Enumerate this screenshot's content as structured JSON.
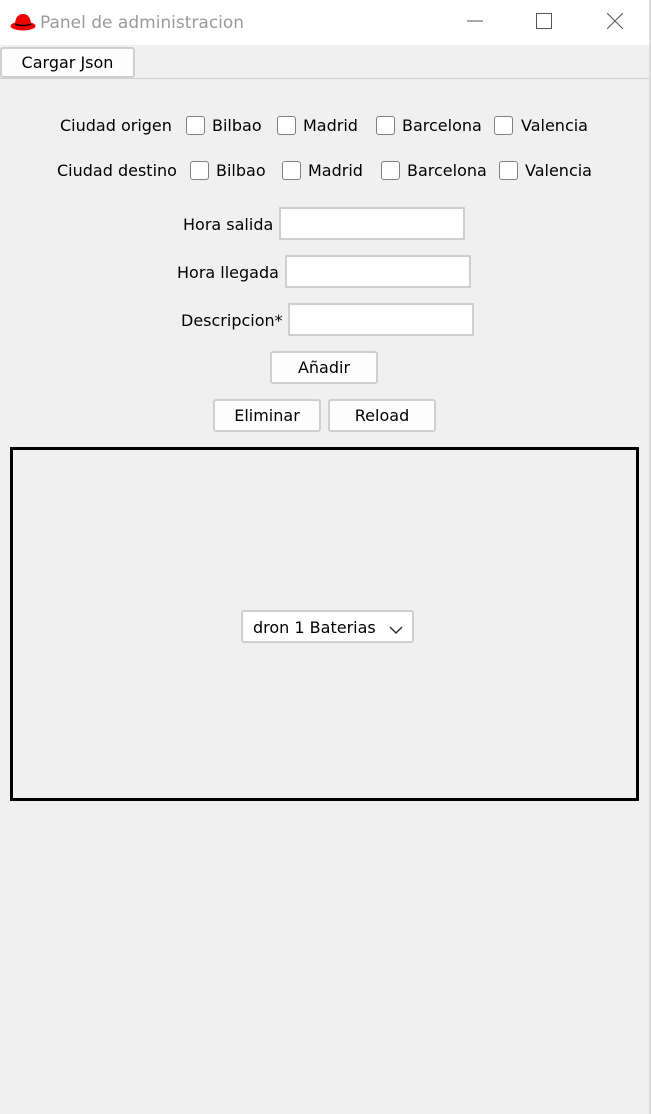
{
  "window": {
    "title": "Panel de administracion",
    "icon": "red-hat-icon",
    "controls": [
      "minimize-icon",
      "maximize-icon",
      "close-icon"
    ]
  },
  "toolbar": {
    "load_json_label": "Cargar Json"
  },
  "origin": {
    "label": "Ciudad origen",
    "cities": [
      "Bilbao",
      "Madrid",
      "Barcelona",
      "Valencia"
    ]
  },
  "destination": {
    "label": "Ciudad destino",
    "cities": [
      "Bilbao",
      "Madrid",
      "Barcelona",
      "Valencia"
    ]
  },
  "form": {
    "departure_label": "Hora salida",
    "departure_value": "",
    "arrival_label": "Hora llegada",
    "arrival_value": "",
    "description_label": "Descripcion*",
    "description_value": ""
  },
  "actions": {
    "add_label": "Añadir",
    "delete_label": "Eliminar",
    "reload_label": "Reload"
  },
  "panel": {
    "selected_option": "dron 1 Baterias"
  },
  "colors": {
    "accent": "#ee0000",
    "background": "#f0f0f0"
  }
}
